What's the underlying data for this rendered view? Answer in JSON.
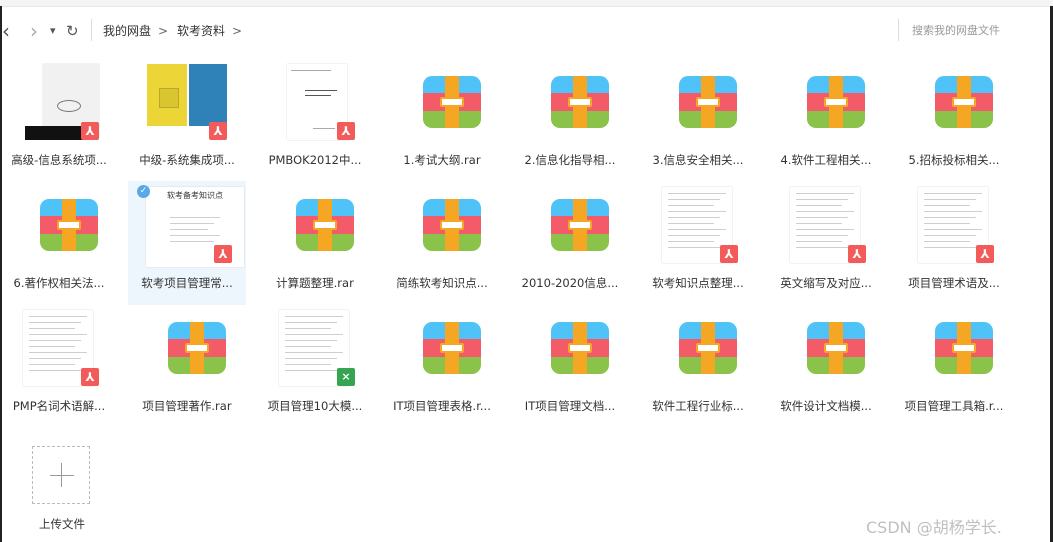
{
  "nav": {
    "back_glyph": "‹",
    "forward_glyph": "›",
    "dropdown_glyph": "▾",
    "refresh_glyph": "↻"
  },
  "breadcrumb": {
    "items": [
      "我的网盘",
      "软考资料"
    ],
    "separator": ">"
  },
  "search": {
    "placeholder": "搜索我的网盘文件"
  },
  "files": [
    {
      "name": "高级-信息系统项...",
      "type": "pdf"
    },
    {
      "name": "中级-系统集成项...",
      "type": "pdf"
    },
    {
      "name": "PMBOK2012中...",
      "type": "pdf"
    },
    {
      "name": "1.考试大纲.rar",
      "type": "rar"
    },
    {
      "name": "2.信息化指导相...",
      "type": "rar"
    },
    {
      "name": "3.信息安全相关...",
      "type": "rar"
    },
    {
      "name": "4.软件工程相关...",
      "type": "rar"
    },
    {
      "name": "5.招标投标相关...",
      "type": "rar"
    },
    {
      "name": "6.著作权相关法...",
      "type": "rar"
    },
    {
      "name": "软考项目管理常...",
      "type": "pdf",
      "selected": true
    },
    {
      "name": "计算题整理.rar",
      "type": "rar"
    },
    {
      "name": "简练软考知识点...",
      "type": "rar"
    },
    {
      "name": "2010-2020信息...",
      "type": "rar"
    },
    {
      "name": "软考知识点整理...",
      "type": "pdf"
    },
    {
      "name": "英文缩写及对应...",
      "type": "pdf"
    },
    {
      "name": "项目管理术语及...",
      "type": "pdf"
    },
    {
      "name": "PMP名词术语解...",
      "type": "pdf"
    },
    {
      "name": "项目管理著作.rar",
      "type": "rar"
    },
    {
      "name": "项目管理10大模...",
      "type": "xls"
    },
    {
      "name": "IT项目管理表格.r...",
      "type": "rar"
    },
    {
      "name": "IT项目管理文档...",
      "type": "rar"
    },
    {
      "name": "软件工程行业标...",
      "type": "rar"
    },
    {
      "name": "软件设计文档模...",
      "type": "rar"
    },
    {
      "name": "项目管理工具箱.r...",
      "type": "rar"
    }
  ],
  "thumb_text": {
    "selected_doc_title": "软考备考知识点"
  },
  "upload": {
    "label": "上传文件"
  },
  "watermark": "CSDN @胡杨学长.",
  "colors": {
    "zip_blue": "#4fc3f7",
    "zip_red": "#f45b69",
    "zip_green": "#8bc34a",
    "zip_strap": "#f5a623",
    "pdf_badge": "#f35a5a",
    "xls_badge": "#35a552",
    "selected_bg": "#eef6fd"
  }
}
